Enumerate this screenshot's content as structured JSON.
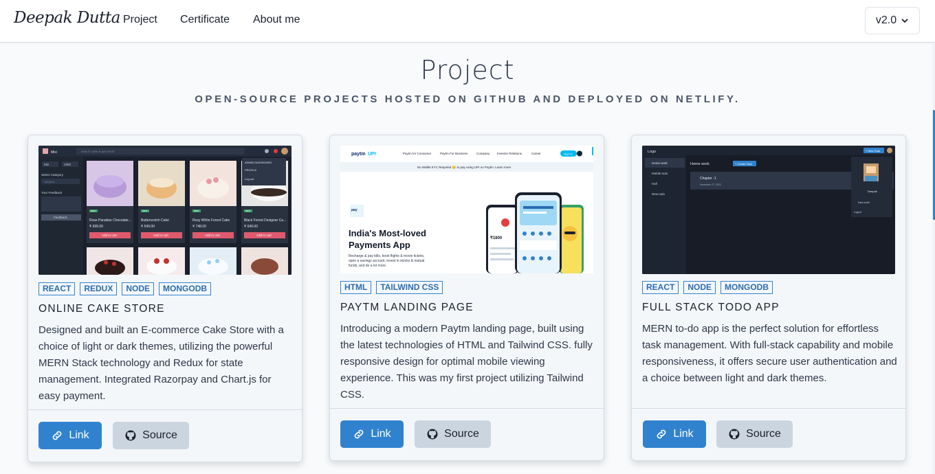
{
  "navbar": {
    "brand": "Deepak Dutta",
    "links": [
      "Project",
      "Certificate",
      "About me"
    ],
    "version": "v2.0"
  },
  "page": {
    "title": "Project",
    "subtitle": "OPEN-SOURCE PROJECTS HOSTED ON GITHUB AND DEPLOYED ON NETLIFY."
  },
  "projects": [
    {
      "tags": [
        "REACT",
        "REDUX",
        "NODE",
        "MONGODB"
      ],
      "title": "ONLINE CAKE STORE",
      "description": "Designed and built an E-commerce Cake Store with a choice of light or dark themes, utilizing the powerful MERN Stack technology and Redux for state management. Integrated Razorpay and Chart.js for easy payment.",
      "link_label": "Link",
      "source_label": "Source",
      "screenshot": {
        "search_placeholder": "search cake & get result",
        "menu": [
          "ADMIN DASHBOARD",
          "PROFILE",
          "Log out"
        ],
        "filters": [
          "Min",
          "1000"
        ],
        "select_label": "Select Category",
        "select_value": "category",
        "feedback_label": "Your Feedback",
        "feedback_button": "Feedback",
        "products": [
          {
            "badge": "NEW",
            "name": "Rose Paradise Chocolate...",
            "price": "₹ 699.00",
            "cart": "Add to cart"
          },
          {
            "badge": "NEW",
            "name": "Butterscotch Cake",
            "price": "₹ 549.00",
            "cart": "Add to cart"
          },
          {
            "badge": "NEW",
            "name": "Rosy White Forest Cake",
            "price": "₹ 748.00",
            "cart": "Add to cart"
          },
          {
            "badge": "NEW",
            "name": "Black Forest Designer Ca...",
            "price": "₹ 649.00",
            "cart": "Add to cart"
          }
        ]
      }
    },
    {
      "tags": [
        "HTML",
        "TAILWIND CSS"
      ],
      "title": "PAYTM LANDING PAGE",
      "description": "Introducing a modern Paytm landing page, built using the latest technologies of HTML and Tailwind CSS. fully responsive design for optimal mobile viewing experience. This was my first project utilizing Tailwind CSS.",
      "link_label": "Link",
      "source_label": "Source",
      "screenshot": {
        "nav": [
          "Paytm for Consumer",
          "Paytm For Business",
          "Company",
          "Investor Relations",
          "Career"
        ],
        "signin": "Sign In",
        "banner": "No Wallet KYC Required 😊 to pay using UPI on Paytm. Learn more",
        "headline": "India's Most-loved Payments App",
        "body": "Recharge & pay bills, book flights & movie tickets, open a savings account, invest in stocks & mutual funds, and do a lot more.",
        "balance": "₹1800"
      }
    },
    {
      "tags": [
        "REACT",
        "NODE",
        "MONGODB"
      ],
      "title": "FULL STACK TODO APP",
      "description": "MERN to-do app is the perfect solution for effortless task management. With full-stack capability and mobile responsiveness, it offers secure user authentication and a choice between light and dark themes.",
      "link_label": "Link",
      "source_label": "Source",
      "screenshot": {
        "logo": "Logo",
        "new_todo": "+ New Todo",
        "sidebar": [
          "Home work",
          "Mobile todo",
          "Hall",
          "New todo"
        ],
        "list_title": "Home work",
        "create_task": "+ Create Task",
        "task": "Chapter -1",
        "task_meta": "November 27, 2023",
        "user": "Deepak",
        "user_menu": [
          "Dark mode",
          "Logout"
        ]
      }
    }
  ],
  "colors": {
    "accent": "#3182ce",
    "source_button": "#cbd5e0",
    "page_bg": "#f8fafc",
    "card_bg": "#f4f7fa"
  }
}
